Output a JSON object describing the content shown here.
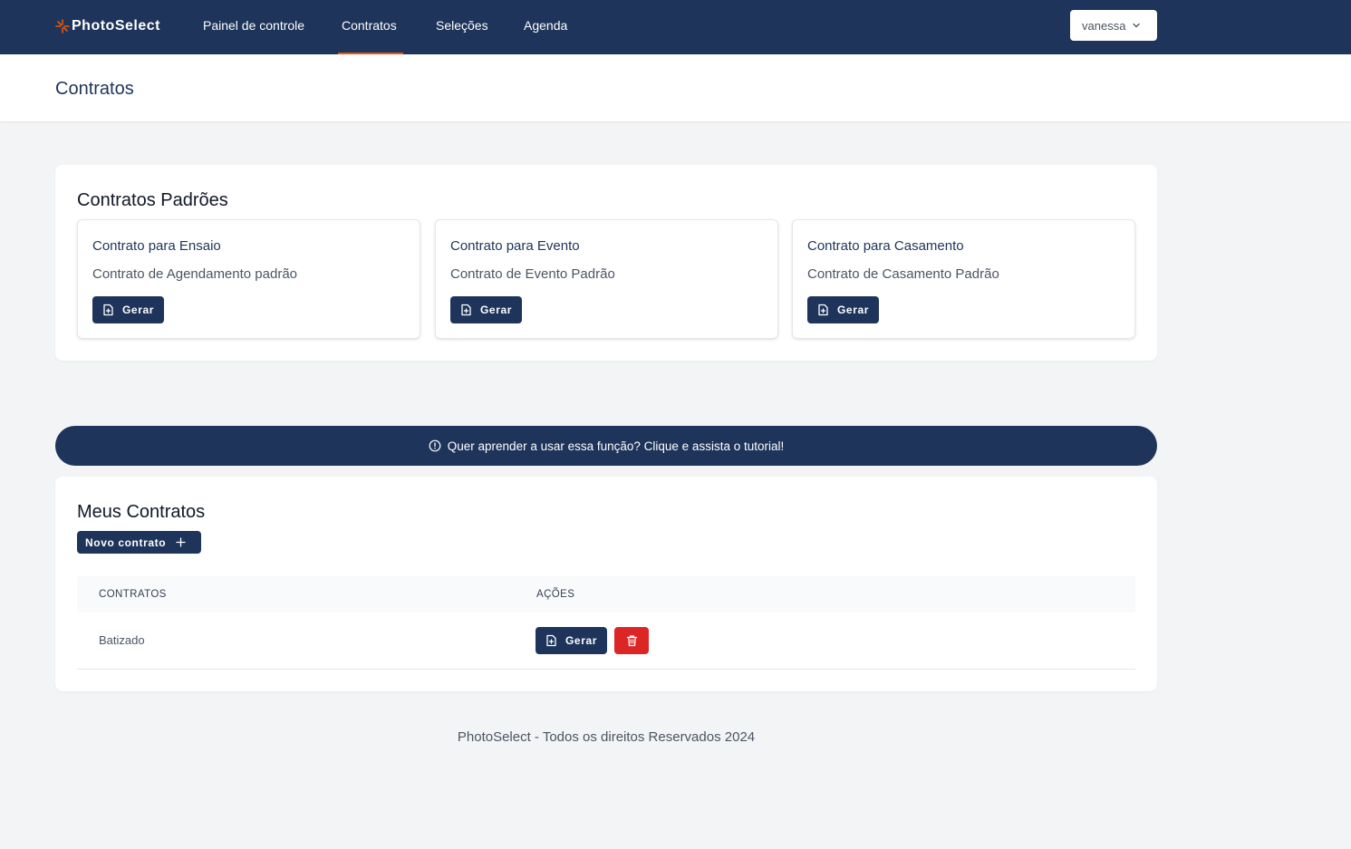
{
  "app": {
    "brand": "PhotoSelect"
  },
  "nav": {
    "items": [
      {
        "label": "Painel de controle"
      },
      {
        "label": "Contratos",
        "active": true
      },
      {
        "label": "Seleções"
      },
      {
        "label": "Agenda"
      }
    ],
    "user": "vanessa"
  },
  "header": {
    "title": "Contratos"
  },
  "standard": {
    "title": "Contratos Padrões",
    "cards": [
      {
        "title": "Contrato para Ensaio",
        "desc": "Contrato de Agendamento padrão",
        "button": "Gerar"
      },
      {
        "title": "Contrato para Evento",
        "desc": "Contrato de Evento Padrão",
        "button": "Gerar"
      },
      {
        "title": "Contrato para Casamento",
        "desc": "Contrato de Casamento Padrão",
        "button": "Gerar"
      }
    ]
  },
  "tutorial": {
    "text": "Quer aprender a usar essa função? Clique e assista o tutorial!"
  },
  "mine": {
    "title": "Meus Contratos",
    "new_button": "Novo contrato",
    "columns": [
      "CONTRATOS",
      "AÇÕES"
    ],
    "rows": [
      {
        "name": "Batizado",
        "button": "Gerar"
      }
    ]
  },
  "footer": {
    "text": "PhotoSelect - Todos os direitos Reservados 2024"
  },
  "colors": {
    "primary": "#1e345a",
    "accent": "#ea580c",
    "danger": "#dc2626",
    "background": "#f3f4f6"
  },
  "icons": {
    "brand": "camera-shutter-icon",
    "user_menu": "chevron-down-icon",
    "gerar": "file-plus-icon",
    "info": "info-circle-icon",
    "add": "plus-icon",
    "delete": "trash-icon"
  }
}
